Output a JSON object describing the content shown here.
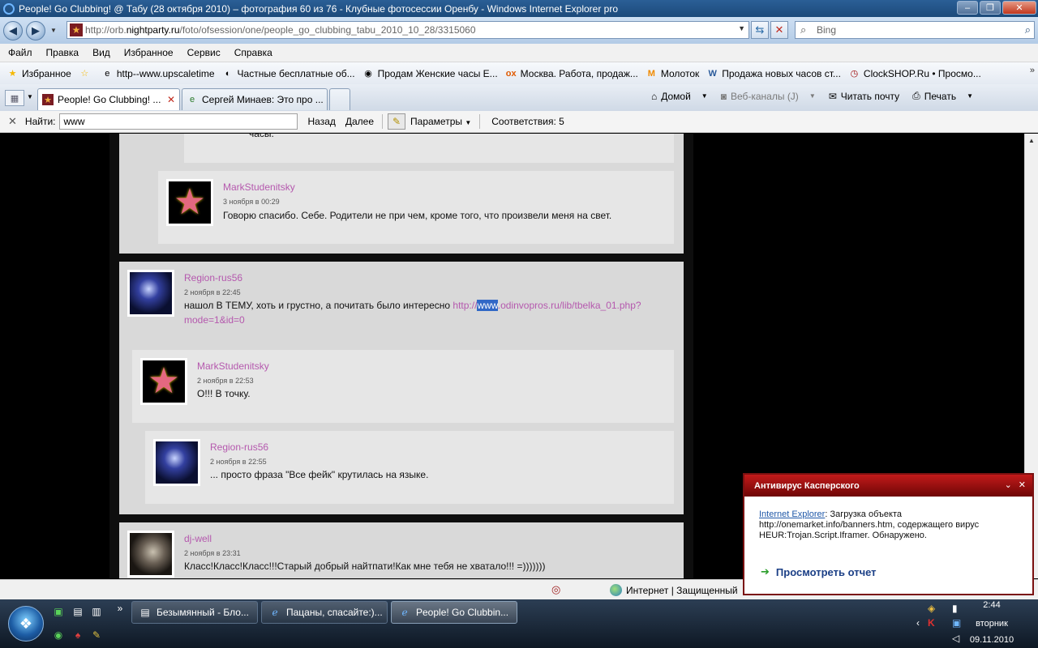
{
  "window": {
    "title": "People! Go Clubbing! @ Табу (28 октября 2010) – фотография 60 из 76 - Клубные фотосессии Оренбу - Windows Internet Explorer pro",
    "min": "–",
    "max": "❐",
    "close": "✕"
  },
  "address": {
    "scheme": "http://orb.",
    "host": "nightparty.ru",
    "path": "/foto/ofsession/one/people_go_clubbing_tabu_2010_10_28/3315060",
    "search_placeholder": "Bing"
  },
  "menu": [
    "Файл",
    "Правка",
    "Вид",
    "Избранное",
    "Сервис",
    "Справка"
  ],
  "favorites": {
    "label": "Избранное",
    "items": [
      {
        "icon": "ie-page-icon",
        "glyph": "e",
        "label": "http--www.upscaletime"
      },
      {
        "icon": "swirl-icon",
        "glyph": "◐",
        "label": "Частные бесплатные об..."
      },
      {
        "icon": "bmw-icon",
        "glyph": "◉",
        "label": "Продам Женские часы Е..."
      },
      {
        "icon": "olx-icon",
        "glyph": "ox",
        "label": "Москва. Работа, продаж..."
      },
      {
        "icon": "molotok-icon",
        "glyph": "M",
        "label": "Молоток"
      },
      {
        "icon": "w-icon",
        "glyph": "W",
        "label": "Продажа новых часов ст..."
      },
      {
        "icon": "clock-icon",
        "glyph": "◷",
        "label": "ClockSHOP.Ru • Просмо..."
      }
    ]
  },
  "tabs": [
    {
      "label": "People! Go Clubbing! ...",
      "active": true
    },
    {
      "label": "Сергей Минаев: Это про ...",
      "active": false
    }
  ],
  "commands": {
    "home": "Домой",
    "feeds": "Веб-каналы (J)",
    "mail": "Читать почту",
    "print": "Печать"
  },
  "find": {
    "close": "✕",
    "label": "Найти:",
    "value": "www",
    "prev": "Назад",
    "next": "Далее",
    "options": "Параметры",
    "matches": "Соответствия: 5"
  },
  "comments": {
    "top_fragment": "часы.",
    "c1": {
      "user": "MarkStudenitsky",
      "date": "3 ноября в 00:29",
      "text": "Говорю спасибо. Себе. Родители не при чем, кроме того, что произвели меня на свет."
    },
    "c2": {
      "user": "Region-rus56",
      "date": "2 ноября в 22:45",
      "text": "нашол В ТЕМУ, хоть и грустно, а почитать было интересно ",
      "link_pre": "http://",
      "link_hl": "www",
      "link_post": ".odinvopros.ru/lib/tbelka_01.php?",
      "link_line2": "mode=1&id=0"
    },
    "c3": {
      "user": "MarkStudenitsky",
      "date": "2 ноября в 22:53",
      "text": "О!!! В точку."
    },
    "c4": {
      "user": "Region-rus56",
      "date": "2 ноября в 22:55",
      "text": "... просто фраза \"Все фейк\" крутилась на языке."
    },
    "c5": {
      "user": "dj-well",
      "date": "2 ноября в 23:31",
      "text": "Класс!Класс!Класс!!!Старый добрый найтпати!Как мне тебя не хватало!!! =)))))))"
    }
  },
  "status": {
    "zone": "Интернет | Защищенный"
  },
  "kaspersky": {
    "title": "Антивирус Касперского",
    "link": "Internet Explorer",
    "message": ": Загрузка объекта http://onemarket.info/banners.htm, содержащего вирус HEUR:Trojan.Script.Iframer. Обнаружено.",
    "report": "Просмотреть отчет"
  },
  "taskbar": {
    "buttons": [
      {
        "label": "Безымянный - Бло...",
        "icon": "notepad-icon"
      },
      {
        "label": "Пацаны, спасайте:)...",
        "icon": "ie-icon"
      },
      {
        "label": "People! Go Clubbin...",
        "icon": "ie-icon"
      }
    ],
    "clock": {
      "time": "2:44",
      "day": "вторник",
      "date": "09.11.2010"
    }
  }
}
